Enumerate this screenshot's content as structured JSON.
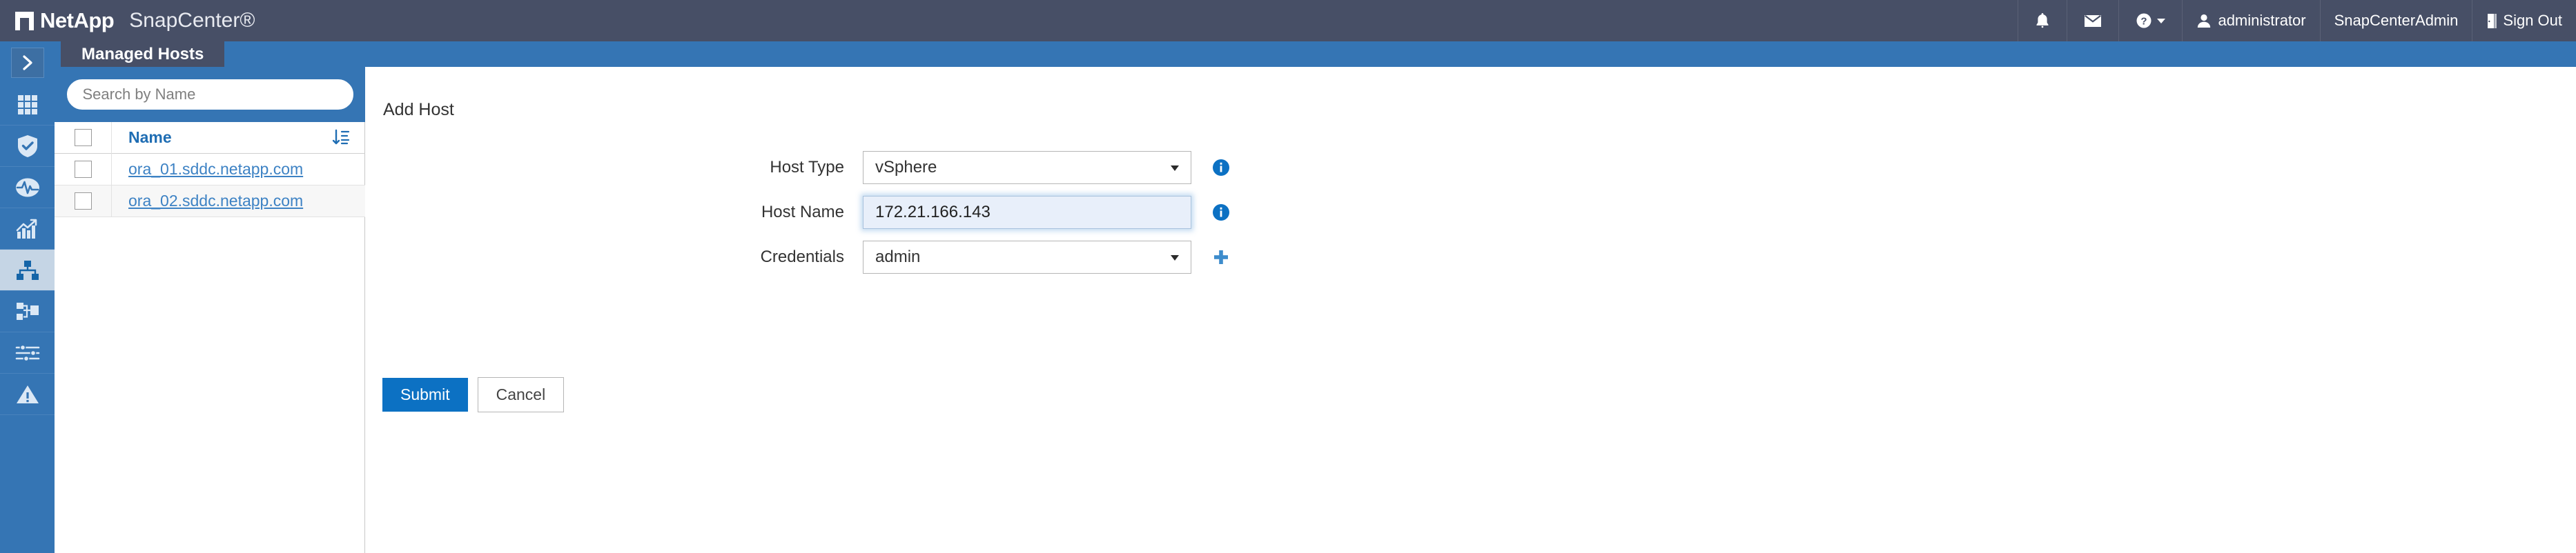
{
  "header": {
    "brand_name": "NetApp",
    "product_name": "SnapCenter®",
    "notifications_icon": "bell-icon",
    "mail_icon": "envelope-icon",
    "help_icon": "question-circle-icon",
    "user_icon": "person-icon",
    "user_name": "administrator",
    "role_name": "SnapCenterAdmin",
    "signout_icon": "door-exit-icon",
    "signout_label": "Sign Out",
    "bg_color": "#474F66"
  },
  "subbar": {
    "bg_color": "#3575B4"
  },
  "sidebar": {
    "toggle": {
      "name": "expand-sidebar-toggle",
      "icon": "chevron-right-icon"
    },
    "items": [
      {
        "name": "dashboard",
        "icon": "grid-dashboard-icon",
        "active": false
      },
      {
        "name": "resources",
        "icon": "shield-check-icon",
        "active": false
      },
      {
        "name": "monitor",
        "icon": "pulse-monitor-icon",
        "active": false
      },
      {
        "name": "reports",
        "icon": "bar-chart-trend-icon",
        "active": false
      },
      {
        "name": "hosts",
        "icon": "hosts-hierarchy-icon",
        "active": true
      },
      {
        "name": "storage-systems",
        "icon": "storage-nodes-icon",
        "active": false
      },
      {
        "name": "settings",
        "icon": "sliders-icon",
        "active": false
      },
      {
        "name": "alerts",
        "icon": "warning-triangle-icon",
        "active": false
      }
    ],
    "active_bg": "#C5D5E5"
  },
  "left_panel": {
    "tab_label": "Managed Hosts",
    "search": {
      "placeholder": "Search by Name",
      "value": ""
    },
    "table": {
      "columns": [
        "Name"
      ],
      "sort_icon": "sort-descending-icon",
      "rows": [
        {
          "name": "ora_01.sddc.netapp.com",
          "checked": false
        },
        {
          "name": "ora_02.sddc.netapp.com",
          "checked": false
        }
      ]
    }
  },
  "main": {
    "title": "Add Host",
    "fields": [
      {
        "label": "Host Type",
        "value": "vSphere",
        "type": "select",
        "hint_icon": "info-icon"
      },
      {
        "label": "Host Name",
        "value": "172.21.166.143",
        "type": "text",
        "hint_icon": "info-icon",
        "focused": true
      },
      {
        "label": "Credentials",
        "value": "admin",
        "type": "select",
        "hint_icon": "plus-icon"
      }
    ],
    "submit_label": "Submit",
    "cancel_label": "Cancel",
    "primary_color": "#0C71C3"
  }
}
